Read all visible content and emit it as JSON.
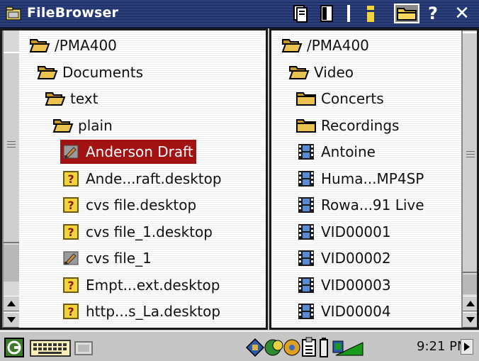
{
  "window": {
    "title": "FileBrowser"
  },
  "left_pane": {
    "items": [
      {
        "label": "/PMA400",
        "type": "folder-open",
        "depth": 0
      },
      {
        "label": "Documents",
        "type": "folder-open",
        "depth": 1
      },
      {
        "label": "text",
        "type": "folder-open",
        "depth": 2
      },
      {
        "label": "plain",
        "type": "folder-open",
        "depth": 3
      },
      {
        "label": "Anderson Draft",
        "type": "document",
        "depth": 4,
        "selected": true
      },
      {
        "label": "Ande...raft.desktop",
        "type": "unknown",
        "depth": 4
      },
      {
        "label": "cvs file.desktop",
        "type": "unknown",
        "depth": 4
      },
      {
        "label": "cvs file_1.desktop",
        "type": "unknown",
        "depth": 4
      },
      {
        "label": "cvs file_1",
        "type": "document",
        "depth": 4
      },
      {
        "label": "Empt...ext.desktop",
        "type": "unknown",
        "depth": 4
      },
      {
        "label": "http...s_La.desktop",
        "type": "unknown",
        "depth": 4
      }
    ]
  },
  "right_pane": {
    "items": [
      {
        "label": "/PMA400",
        "type": "folder-open",
        "depth": 0
      },
      {
        "label": "Video",
        "type": "folder-open",
        "depth": 1
      },
      {
        "label": "Concerts",
        "type": "folder",
        "depth": 2
      },
      {
        "label": "Recordings",
        "type": "folder",
        "depth": 2
      },
      {
        "label": "Antoine",
        "type": "video",
        "depth": 2
      },
      {
        "label": "Huma...MP4SP",
        "type": "video",
        "depth": 2
      },
      {
        "label": "Rowa...91 Live",
        "type": "video",
        "depth": 2
      },
      {
        "label": "VID00001",
        "type": "video",
        "depth": 2
      },
      {
        "label": "VID00002",
        "type": "video",
        "depth": 2
      },
      {
        "label": "VID00003",
        "type": "video",
        "depth": 2
      },
      {
        "label": "VID00004",
        "type": "video",
        "depth": 2
      }
    ]
  },
  "taskbar": {
    "clock": "9:21 PM"
  },
  "colors": {
    "titlebar": "#2a3f7a",
    "selection": "#a31212"
  }
}
